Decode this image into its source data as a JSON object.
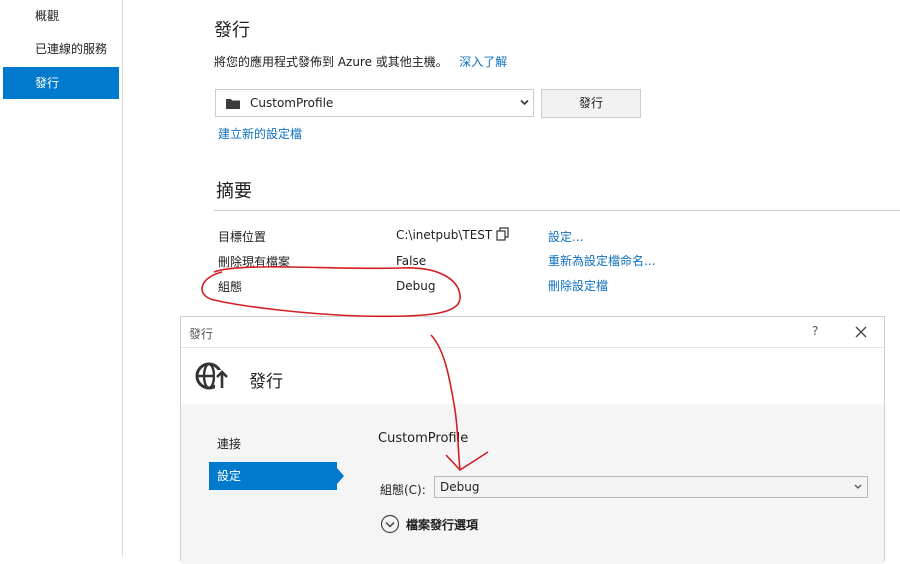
{
  "sidebar": {
    "items": [
      {
        "label": "概觀"
      },
      {
        "label": "已連線的服務"
      },
      {
        "label": "發行",
        "active": true
      }
    ]
  },
  "main": {
    "title": "發行",
    "description": "將您的應用程式發佈到 Azure 或其他主機。",
    "learn_more": "深入了解",
    "profile_value": "CustomProfile",
    "publish_button": "發行",
    "create_profile_link": "建立新的設定檔"
  },
  "summary": {
    "title": "摘要",
    "rows": [
      {
        "label": "目標位置",
        "value": "C:\\inetpub\\TEST",
        "action": "設定..."
      },
      {
        "label": "刪除現有檔案",
        "value": "False",
        "action": "重新為設定檔命名..."
      },
      {
        "label": "組態",
        "value": "Debug",
        "action": "刪除設定檔"
      }
    ]
  },
  "dialog": {
    "window_title": "發行",
    "help": "?",
    "header_title": "發行",
    "nav": [
      {
        "label": "連接"
      },
      {
        "label": "設定",
        "active": true
      }
    ],
    "profile_name": "CustomProfile",
    "config_label": "組態(C):",
    "config_value": "Debug",
    "file_options": "檔案發行選項"
  },
  "colors": {
    "accent": "#007acc",
    "link": "#0e70c0",
    "annotation": "#d21f24"
  }
}
